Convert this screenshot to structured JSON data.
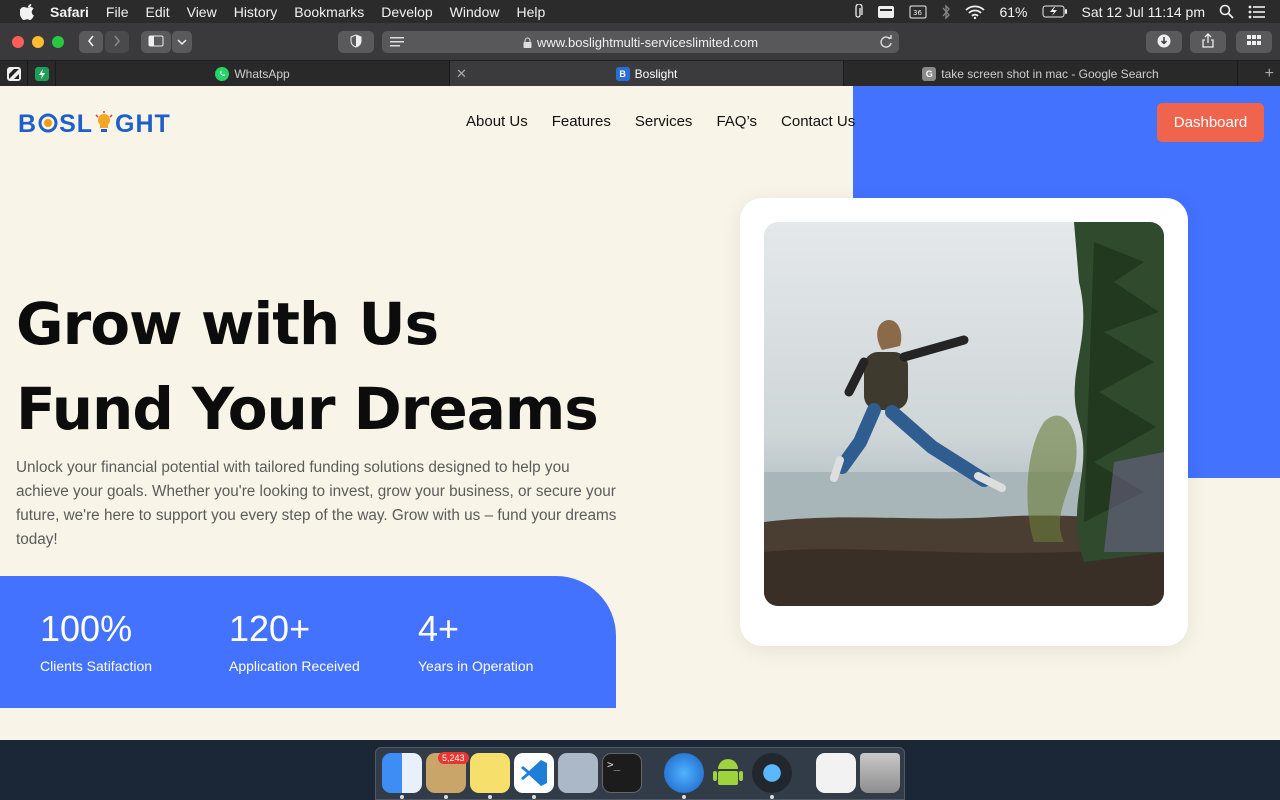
{
  "menubar": {
    "app": "Safari",
    "items": [
      "File",
      "Edit",
      "View",
      "History",
      "Bookmarks",
      "Develop",
      "Window",
      "Help"
    ],
    "battery": "61%",
    "datetime": "Sat 12 Jul  11:14 pm"
  },
  "browser": {
    "url": "www.boslightmulti-serviceslimited.com",
    "tabs": [
      {
        "title": "WhatsApp",
        "icon": "whatsapp-icon"
      },
      {
        "title": "Boslight",
        "icon": "boslight-icon",
        "active": true
      },
      {
        "title": "take screen shot in mac - Google Search",
        "icon": "google-icon"
      }
    ]
  },
  "site": {
    "logo": "BOSLIGHT",
    "nav": [
      "About Us",
      "Features",
      "Services",
      "FAQ’s",
      "Contact Us"
    ],
    "dashboard_label": "Dashboard",
    "hero_line1": "Grow with Us",
    "hero_line2": "Fund Your Dreams",
    "hero_desc": "Unlock your financial potential with tailored funding solutions designed to help you achieve your goals. Whether you're looking to invest, grow your business, or secure your future, we're here to support you every step of the way. Grow with us – fund your dreams today!",
    "stats": [
      {
        "value": "100%",
        "label": "Clients Satifaction"
      },
      {
        "value": "120+",
        "label": "Application Received"
      },
      {
        "value": "4+",
        "label": "Years in Operation"
      }
    ],
    "colors": {
      "accent": "#4372ff",
      "button": "#f0644d",
      "background": "#f8f4e7"
    }
  },
  "dock": {
    "mail_badge": "5,243",
    "apps": [
      "finder-icon",
      "mail-icon",
      "notes-icon",
      "vscode-icon",
      "preview-icon",
      "terminal-icon",
      "safari-icon",
      "android-studio-icon",
      "quicktime-icon",
      "documents-icon",
      "trash-icon"
    ]
  }
}
